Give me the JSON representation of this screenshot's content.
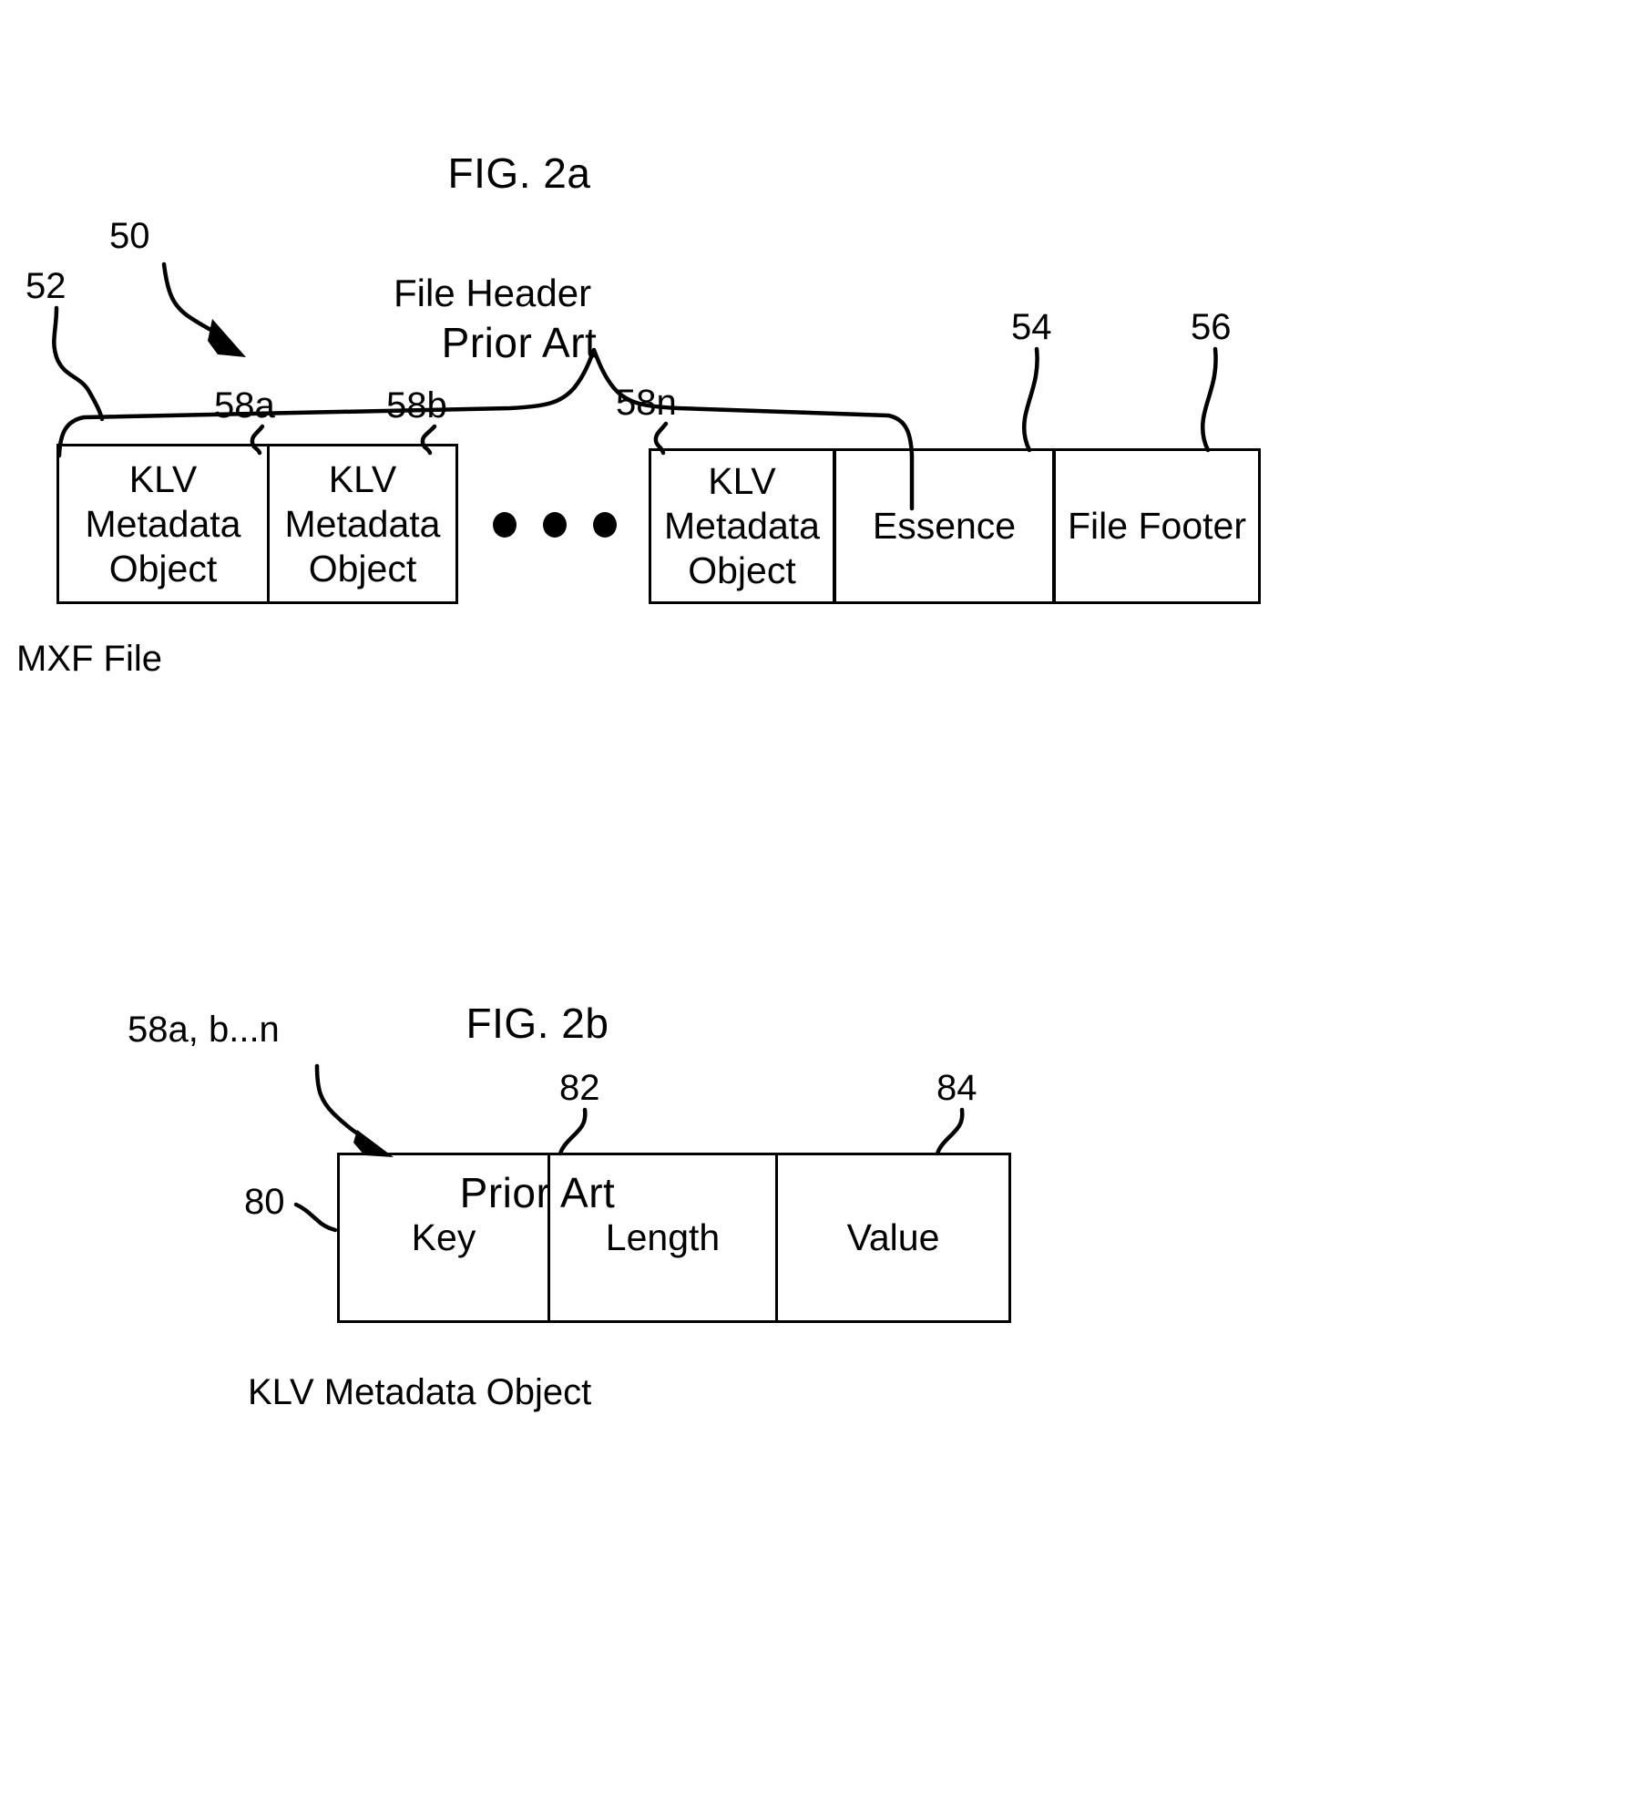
{
  "figures": [
    {
      "id": "fig-2a",
      "title_line1": "FIG. 2a",
      "title_line2": "Prior Art",
      "bracket_label": "File Header",
      "caption": "MXF File",
      "callouts": {
        "assembly": "50",
        "file_header": "52",
        "essence": "54",
        "file_footer": "56",
        "klv_first": "58a",
        "klv_second": "58b",
        "klv_last": "58n"
      },
      "blocks": [
        {
          "name": "klv-metadata-object-1",
          "text": "KLV\nMetadata\nObject"
        },
        {
          "name": "klv-metadata-object-2",
          "text": "KLV\nMetadata\nObject"
        },
        {
          "name": "ellipsis",
          "text": "• • •"
        },
        {
          "name": "klv-metadata-object-n",
          "text": "KLV\nMetadata\nObject"
        },
        {
          "name": "essence",
          "text": "Essence"
        },
        {
          "name": "file-footer",
          "text": "File Footer"
        }
      ]
    },
    {
      "id": "fig-2b",
      "title_line1": "FIG. 2b",
      "title_line2": "Prior Art",
      "caption": "KLV Metadata Object",
      "callouts": {
        "klv_object": "58a, b...n",
        "key": "80",
        "length": "82",
        "value": "84"
      },
      "blocks": [
        {
          "name": "key-field",
          "text": "Key"
        },
        {
          "name": "length-field",
          "text": "Length"
        },
        {
          "name": "value-field",
          "text": "Value"
        }
      ]
    }
  ],
  "colors": {
    "ink": "#000000",
    "paper": "#ffffff"
  }
}
